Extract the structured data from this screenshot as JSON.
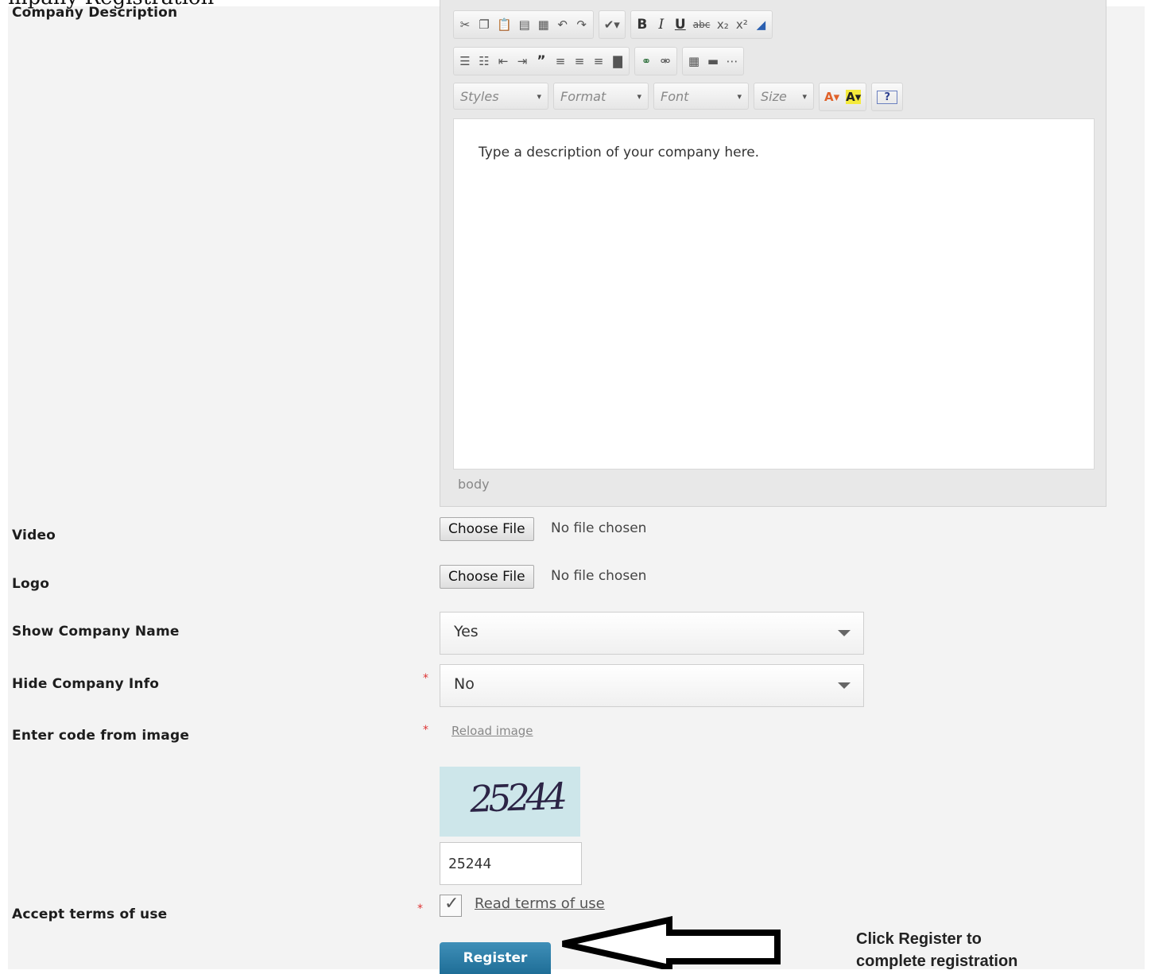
{
  "page_heading_fragment": "mpany Registration",
  "fields": {
    "company_description": {
      "label": "Company Description"
    },
    "video": {
      "label": "Video",
      "button": "Choose File",
      "status": "No file chosen"
    },
    "logo": {
      "label": "Logo",
      "button": "Choose File",
      "status": "No file chosen"
    },
    "show_company_name": {
      "label": "Show Company Name",
      "value": "Yes"
    },
    "hide_company_info": {
      "label": "Hide Company Info",
      "value": "No",
      "required_mark": "*"
    },
    "captcha": {
      "label": "Enter code from image",
      "required_mark": "*",
      "reload_link": "Reload image",
      "image_text": "25244",
      "input_value": "25244"
    },
    "terms": {
      "label": "Accept terms of use",
      "required_mark": "*",
      "checked": true,
      "link": "Read terms of use"
    }
  },
  "editor": {
    "toolbar_row1": [
      "cut-icon",
      "copy-icon",
      "paste-icon",
      "paste-text-icon",
      "paste-word-icon",
      "undo-icon",
      "redo-icon",
      "spellcheck-icon",
      "bold-icon",
      "italic-icon",
      "underline-icon",
      "strike-icon",
      "subscript-icon",
      "superscript-icon",
      "remove-format-icon"
    ],
    "toolbar_row2": [
      "numbered-list-icon",
      "bulleted-list-icon",
      "outdent-icon",
      "indent-icon",
      "blockquote-icon",
      "align-left-icon",
      "align-center-icon",
      "align-right-icon",
      "justify-icon",
      "link-icon",
      "unlink-icon",
      "table-icon",
      "horizontal-rule-icon",
      "page-break-icon"
    ],
    "combos": {
      "styles": "Styles",
      "format": "Format",
      "font": "Font",
      "size": "Size"
    },
    "glyphs": {
      "bold": "B",
      "italic": "I",
      "underline": "U",
      "strike": "abc",
      "subscript": "x₂",
      "superscript": "x²",
      "help": "?"
    },
    "content": "Type a description of your company here.",
    "path": "body"
  },
  "actions": {
    "register": "Register"
  },
  "annotation": {
    "line1": "Click Register to",
    "line2": "complete registration"
  },
  "colors": {
    "register": "#2c7aa6",
    "required": "#dd3333"
  }
}
